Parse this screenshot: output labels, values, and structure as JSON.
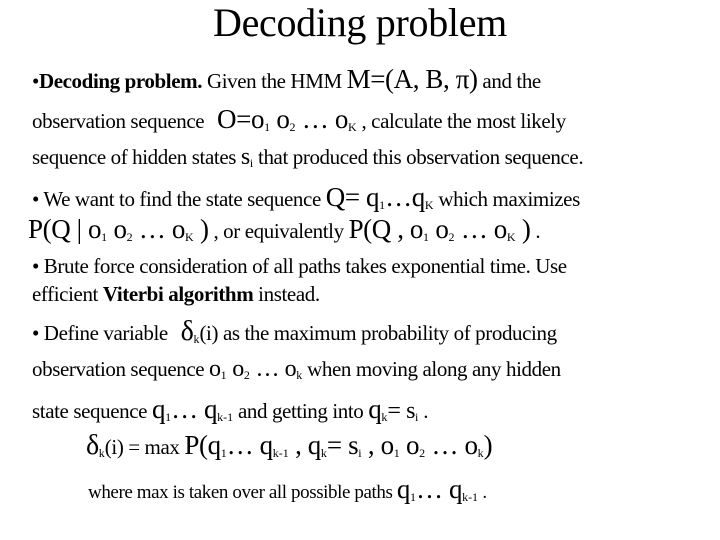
{
  "slide": {
    "title": "Decoding problem",
    "bullet": "•",
    "p1": {
      "lead_bold": "Decoding problem.",
      "t1": " Given the HMM ",
      "model": "M=(A, B, π)",
      "t2": "  and  the",
      "t3": "observation sequence ",
      "O_eq": "O=o",
      "s1": "1",
      "o2": " o",
      "s2": "2",
      "dots": " … o",
      "sK": "K",
      "t4": " , calculate the most likely",
      "t5": "sequence of hidden states ",
      "s_i": "s",
      "sub_i": "i",
      "t6": " that produced this observation sequence."
    },
    "p2": {
      "t1": " We want to find the state sequence ",
      "Q_eq": "Q= q",
      "s1": "1",
      "dots": "…q",
      "sK": "K",
      "t2": " which maximizes",
      "P1": "P(Q | o",
      "o2": " o",
      "s2": "2",
      "o_dots": " … o",
      "close1": " )",
      "t3": " , or equivalently ",
      "P2": "P(Q , o",
      "close2": " )",
      "end": " ."
    },
    "p3": {
      "t1": " Brute force consideration of all paths takes exponential time. Use",
      "t2": "efficient ",
      "bold": "Viterbi  algorithm",
      "t3": " instead."
    },
    "p4": {
      "t1": " Define variable ",
      "delta": "δ",
      "sub_k": "k",
      "arg": "(i)",
      "t2": "  as the maximum probability of producing",
      "t3": "observation sequence ",
      "o": "o",
      "s1": "1",
      "s2": "2",
      "dots": " … o",
      "t4": " when moving along any hidden",
      "t5": "state sequence ",
      "q": "q",
      "qdots": "…  q",
      "km1": "k-1",
      "t6": " and getting into ",
      "qk_eq": "= s",
      "sub_i": "i",
      "end": "  ."
    },
    "formula": {
      "delta": "δ",
      "sub_k": "k",
      "arg": "(i) = max ",
      "P": "P(q",
      "s1": "1",
      "qdots": "…  q",
      "km1": "k-1",
      "comma_q": " , q",
      "eq_s": "= s",
      "sub_i": "i",
      "comma_o": " , o",
      "o2": " o",
      "s2": "2",
      "odots": " … o",
      "close": ")"
    },
    "note": {
      "t1": "where max is taken over all possible paths ",
      "q": "q",
      "s1": "1",
      "qdots": "…  q",
      "km1": "k-1",
      "end": " ."
    }
  }
}
